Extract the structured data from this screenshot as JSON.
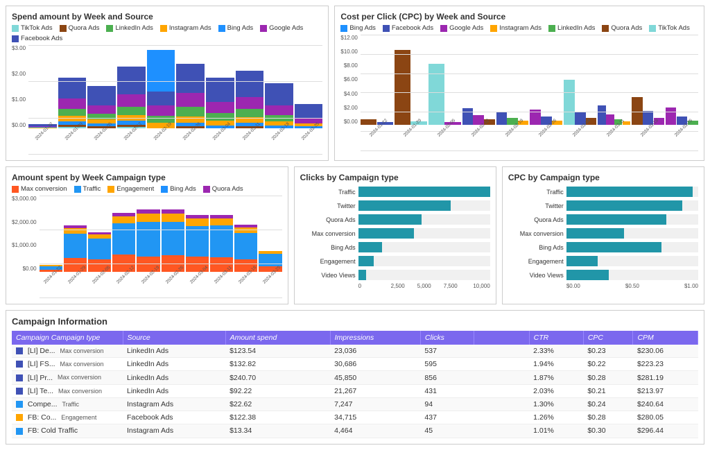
{
  "charts": {
    "spendByWeek": {
      "title": "Spend amount by Week and Source",
      "legend": [
        {
          "label": "TikTok Ads",
          "color": "#80d8d8"
        },
        {
          "label": "Quora Ads",
          "color": "#8B4513"
        },
        {
          "label": "LinkedIn Ads",
          "color": "#4CAF50"
        },
        {
          "label": "Instagram Ads",
          "color": "#FFA500"
        },
        {
          "label": "Bing Ads",
          "color": "#1E90FF"
        },
        {
          "label": "Google Ads",
          "color": "#9C27B0"
        },
        {
          "label": "Facebook Ads",
          "color": "#3F51B5"
        }
      ],
      "yLabels": [
        "$3.00",
        "$2.00",
        "$1.00",
        "$0.00"
      ],
      "xLabels": [
        "2024-01-22",
        "2024-01-29",
        "2024-02-05",
        "2024-02-12",
        "2024-02-19",
        "2024-02-26",
        "2024-03-04",
        "2024-03-11",
        "2024-03-18",
        "2024-03-25"
      ]
    },
    "cpcByWeek": {
      "title": "Cost per Click (CPC) by Week and Source",
      "legend": [
        {
          "label": "Bing Ads",
          "color": "#1E90FF"
        },
        {
          "label": "Facebook Ads",
          "color": "#3F51B5"
        },
        {
          "label": "Google Ads",
          "color": "#9C27B0"
        },
        {
          "label": "Instagram Ads",
          "color": "#FFA500"
        },
        {
          "label": "LinkedIn Ads",
          "color": "#4CAF50"
        },
        {
          "label": "Quora Ads",
          "color": "#8B4513"
        },
        {
          "label": "TikTok Ads",
          "color": "#80d8d8"
        }
      ],
      "yLabels": [
        "$12.00",
        "$10.00",
        "$8.00",
        "$6.00",
        "$4.00",
        "$2.00",
        "$0.00"
      ],
      "xLabels": [
        "2024-01-22",
        "2024-01-29",
        "2024-02-05",
        "2024-02-12",
        "2024-02-19",
        "2024-02-26",
        "2024-03-04",
        "2024-03-11",
        "2024-03-18",
        "2024-03-25"
      ]
    },
    "amountByCampaign": {
      "title": "Amount spent by Week Campaign type",
      "legend": [
        {
          "label": "Max conversion",
          "color": "#FF5722"
        },
        {
          "label": "Traffic",
          "color": "#2196F3"
        },
        {
          "label": "Engagement",
          "color": "#FFA500"
        },
        {
          "label": "Bing Ads",
          "color": "#1E90FF"
        },
        {
          "label": "Quora Ads",
          "color": "#9C27B0"
        }
      ],
      "yLabels": [
        "$3,000.00",
        "$2,000.00",
        "$1,000.00",
        "$0.00"
      ],
      "xLabels": [
        "2024-01-22",
        "2024-01-29",
        "2024-02-05",
        "2024-02-12",
        "2024-02-19",
        "2024-02-26",
        "2024-03-04",
        "2024-03-11",
        "2024-03-18",
        "2024-03-25"
      ]
    },
    "clicksByCampaign": {
      "title": "Clicks by Campaign type",
      "bars": [
        {
          "label": "Traffic",
          "value": 10000,
          "color": "#2196a8"
        },
        {
          "label": "Twitter",
          "value": 7000,
          "color": "#2196a8"
        },
        {
          "label": "Quora Ads",
          "value": 4800,
          "color": "#2196a8"
        },
        {
          "label": "Max conversion",
          "value": 4200,
          "color": "#2196a8"
        },
        {
          "label": "Bing Ads",
          "value": 1800,
          "color": "#2196a8"
        },
        {
          "label": "Engagement",
          "value": 1200,
          "color": "#2196a8"
        },
        {
          "label": "Video Views",
          "value": 600,
          "color": "#2196a8"
        }
      ],
      "xLabels": [
        "0",
        "2,500",
        "5,000",
        "7,500",
        "10,000"
      ],
      "maxVal": 10000
    },
    "cpcByCampaign": {
      "title": "CPC by Campaign type",
      "bars": [
        {
          "label": "Traffic",
          "value": 1.2,
          "color": "#2196a8"
        },
        {
          "label": "Twitter",
          "value": 1.1,
          "color": "#2196a8"
        },
        {
          "label": "Quora Ads",
          "value": 0.95,
          "color": "#2196a8"
        },
        {
          "label": "Max conversion",
          "value": 0.55,
          "color": "#2196a8"
        },
        {
          "label": "Bing Ads",
          "value": 0.9,
          "color": "#2196a8"
        },
        {
          "label": "Engagement",
          "value": 0.3,
          "color": "#2196a8"
        },
        {
          "label": "Video Views",
          "value": 0.4,
          "color": "#2196a8"
        }
      ],
      "xLabels": [
        "$0.00",
        "$0.50",
        "$1.00"
      ],
      "maxVal": 1.25
    }
  },
  "table": {
    "title": "Campaign Information",
    "columns": [
      "Campaign Campaign type",
      "Source",
      "Amount spend",
      "Impressions",
      "Clicks",
      "",
      "CTR",
      "CPC",
      "CPM"
    ],
    "rows": [
      {
        "badge": "#3F51B5",
        "name": "[LI] De...",
        "type": "Max conversion",
        "source": "LinkedIn Ads",
        "spend": "$123.54",
        "impressions": "23,036",
        "clicks": "537",
        "ctr": "2.33%",
        "cpc": "$0.23",
        "cpm": "$230.06"
      },
      {
        "badge": "#3F51B5",
        "name": "[LI] FS...",
        "type": "Max conversion",
        "source": "LinkedIn Ads",
        "spend": "$132.82",
        "impressions": "30,686",
        "clicks": "595",
        "ctr": "1.94%",
        "cpc": "$0.22",
        "cpm": "$223.23"
      },
      {
        "badge": "#3F51B5",
        "name": "[LI] Pr...",
        "type": "Max conversion",
        "source": "LinkedIn Ads",
        "spend": "$240.70",
        "impressions": "45,850",
        "clicks": "856",
        "ctr": "1.87%",
        "cpc": "$0.28",
        "cpm": "$281.19"
      },
      {
        "badge": "#3F51B5",
        "name": "[LI] Te...",
        "type": "Max conversion",
        "source": "LinkedIn Ads",
        "spend": "$92.22",
        "impressions": "21,267",
        "clicks": "431",
        "ctr": "2.03%",
        "cpc": "$0.21",
        "cpm": "$213.97"
      },
      {
        "badge": "#2196F3",
        "name": "Compe...",
        "type": "Traffic",
        "source": "Instagram Ads",
        "spend": "$22.62",
        "impressions": "7,247",
        "clicks": "94",
        "ctr": "1.30%",
        "cpc": "$0.24",
        "cpm": "$240.64"
      },
      {
        "badge": "#FFA500",
        "name": "FB: Co...",
        "type": "Engagement",
        "source": "Facebook Ads",
        "spend": "$122.38",
        "impressions": "34,715",
        "clicks": "437",
        "ctr": "1.26%",
        "cpc": "$0.28",
        "cpm": "$280.05"
      },
      {
        "badge": "#2196F3",
        "name": "FB: Cold Traffic",
        "type": "",
        "source": "Instagram Ads",
        "spend": "$13.34",
        "impressions": "4,464",
        "clicks": "45",
        "ctr": "1.01%",
        "cpc": "$0.30",
        "cpm": "$296.44"
      }
    ]
  }
}
